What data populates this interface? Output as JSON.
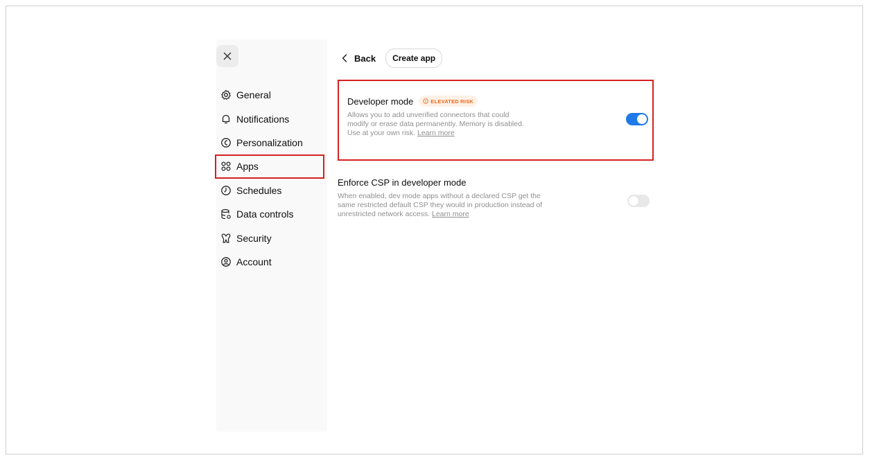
{
  "sidebar": {
    "close_icon": "close-icon",
    "items": [
      {
        "label": "General",
        "icon": "gear-icon"
      },
      {
        "label": "Notifications",
        "icon": "bell-icon"
      },
      {
        "label": "Personalization",
        "icon": "personalization-icon"
      },
      {
        "label": "Apps",
        "icon": "apps-grid-icon",
        "active": true
      },
      {
        "label": "Schedules",
        "icon": "clock-icon"
      },
      {
        "label": "Data controls",
        "icon": "database-icon"
      },
      {
        "label": "Security",
        "icon": "security-icon"
      },
      {
        "label": "Account",
        "icon": "account-icon"
      }
    ]
  },
  "main": {
    "back_label": "Back",
    "create_app_label": "Create app",
    "settings": [
      {
        "title": "Developer mode",
        "badge": "ELEVATED RISK",
        "description": "Allows you to add unverified connectors that could modify or erase data permanently. Memory is disabled. Use at your own risk.",
        "link": "Learn more",
        "enabled": true
      },
      {
        "title": "Enforce CSP in developer mode",
        "description": "When enabled, dev mode apps without a declared CSP get the same restricted default CSP they would in production instead of unrestricted network access.",
        "link": "Learn more",
        "enabled": false
      }
    ]
  },
  "colors": {
    "accent": "#1f7ae8",
    "highlight": "#d42121",
    "badge_text": "#e8691f",
    "badge_bg": "#fff1e6"
  }
}
